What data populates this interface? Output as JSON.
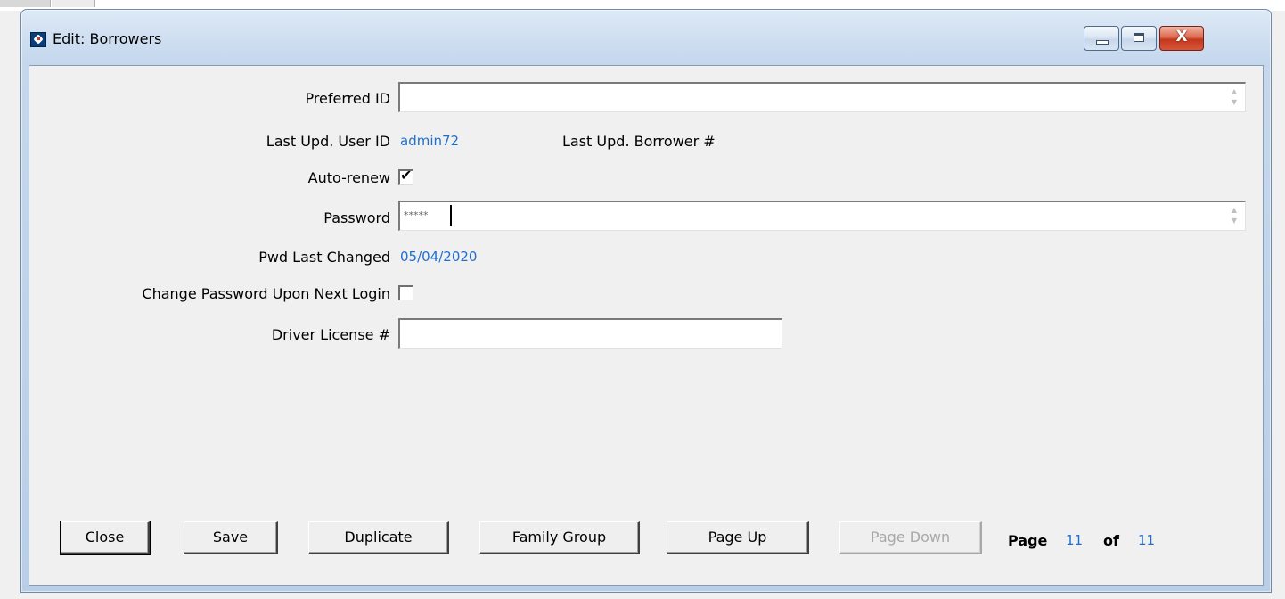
{
  "window": {
    "title": "Edit: Borrowers",
    "close_glyph": "X"
  },
  "form": {
    "preferred_id": {
      "label": "Preferred ID",
      "value": ""
    },
    "last_upd_user_id": {
      "label": "Last Upd. User ID",
      "value": "admin72"
    },
    "last_upd_borrower": {
      "label": "Last Upd. Borrower #",
      "value": ""
    },
    "auto_renew": {
      "label": "Auto-renew",
      "checked": true
    },
    "password": {
      "label": "Password",
      "value": "*****"
    },
    "pwd_last_changed": {
      "label": "Pwd Last Changed",
      "value": "05/04/2020"
    },
    "change_pwd_next_login": {
      "label": "Change Password Upon Next Login",
      "checked": false
    },
    "driver_license": {
      "label": "Driver License #",
      "value": ""
    }
  },
  "buttons": {
    "close": "Close",
    "save": "Save",
    "duplicate": "Duplicate",
    "family_group": "Family Group",
    "page_up": "Page Up",
    "page_down": "Page Down"
  },
  "pagination": {
    "page_label": "Page",
    "current": "11",
    "of_label": "of",
    "total": "11"
  },
  "icons": {
    "app": "app-icon",
    "minimize": "minimize-icon",
    "maximize": "maximize-icon",
    "close": "close-icon",
    "checkmark": "✔"
  },
  "colors": {
    "value_text": "#1e6fd0",
    "close_button": "#c4381c"
  }
}
